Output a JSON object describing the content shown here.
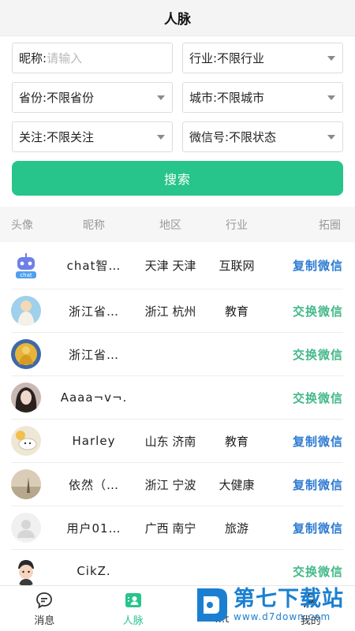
{
  "header": {
    "title": "人脉"
  },
  "filters": {
    "nickname_label": "昵称:",
    "nickname_placeholder": "请输入",
    "industry": "行业:不限行业",
    "province": "省份:不限省份",
    "city": "城市:不限城市",
    "follow": "关注:不限关注",
    "wechat": "微信号:不限状态"
  },
  "search_button": "搜索",
  "table": {
    "headers": [
      "头像",
      "昵称",
      "地区",
      "行业",
      "拓圈"
    ],
    "rows": [
      {
        "name": "chat智…",
        "area": "天津 天津",
        "industry": "互联网",
        "action": "复制微信",
        "action_type": "copy",
        "avatar": "robot-avatar"
      },
      {
        "name": "浙江省…",
        "area": "浙江 杭州",
        "industry": "教育",
        "action": "交换微信",
        "action_type": "swap",
        "avatar": "deity-avatar"
      },
      {
        "name": "浙江省…",
        "area": "",
        "industry": "",
        "action": "交换微信",
        "action_type": "swap",
        "avatar": "buddha-avatar"
      },
      {
        "name": "Aaaa¬v¬.",
        "area": "",
        "industry": "",
        "action": "交换微信",
        "action_type": "swap",
        "avatar": "girl-photo-avatar"
      },
      {
        "name": "Harley",
        "area": "山东 济南",
        "industry": "教育",
        "action": "复制微信",
        "action_type": "copy",
        "avatar": "cartoon-avatar"
      },
      {
        "name": "依然（…",
        "area": "浙江 宁波",
        "industry": "大健康",
        "action": "复制微信",
        "action_type": "copy",
        "avatar": "landscape-avatar"
      },
      {
        "name": "用户01…",
        "area": "广西 南宁",
        "industry": "旅游",
        "action": "复制微信",
        "action_type": "copy",
        "avatar": "default-user-avatar"
      },
      {
        "name": "CikZ.",
        "area": "",
        "industry": "",
        "action": "交换微信",
        "action_type": "swap",
        "avatar": "boy-cartoon-avatar"
      }
    ]
  },
  "tabbar": {
    "items": [
      {
        "label": "消息",
        "icon": "message-icon",
        "active": false
      },
      {
        "label": "人脉",
        "icon": "contacts-icon",
        "active": true
      },
      {
        "label": "…t",
        "icon": "",
        "active": false
      },
      {
        "label": "我的",
        "icon": "user-icon",
        "active": false
      }
    ]
  },
  "watermark": {
    "big": "第七下载站",
    "small": "www.d7down.com"
  },
  "colors": {
    "accent": "#27c48c",
    "copy": "#2e7bd1",
    "swap": "#45b98a"
  }
}
